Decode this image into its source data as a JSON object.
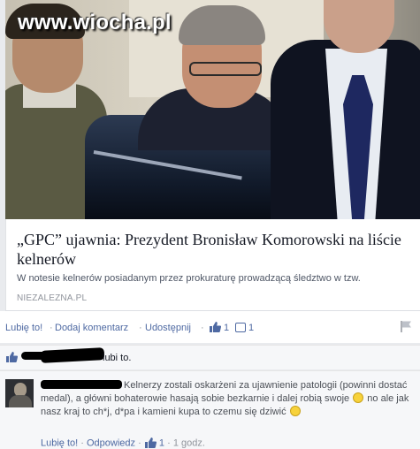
{
  "watermark": "www.wiocha.pl",
  "article": {
    "title": "„GPC” ujawnia: Prezydent Bronisław Komorowski na liście kelnerów",
    "description": "W notesie kelnerów posiadanym przez prokuraturę prowadzącą śledztwo w tzw.",
    "domain": "NIEZALEZNA.PL"
  },
  "actions": {
    "like": "Lubię to!",
    "comment": "Dodaj komentarz",
    "share": "Udostępnij",
    "separator": "·",
    "like_count": "1",
    "comment_count": "1"
  },
  "likes_row": {
    "suffix": "lubi to."
  },
  "comment": {
    "text_part1": "Kelnerzy zostali oskarżeni za ujawnienie patologii (powinni dostać medal), a główni bohaterowie hasają sobie bezkarnie i dalej robią swoje",
    "text_part2": "no ale jak nasz kraj to ch*j, d*pa i kamieni kupa to czemu się dziwić",
    "like": "Lubię to!",
    "reply": "Odpowiedz",
    "like_count": "1",
    "time": "1 godz.",
    "separator": "·"
  },
  "colors": {
    "link": "#4e69a2",
    "background": "#e9ebee",
    "card": "#ffffff",
    "comment_bg": "#f6f7f9"
  }
}
